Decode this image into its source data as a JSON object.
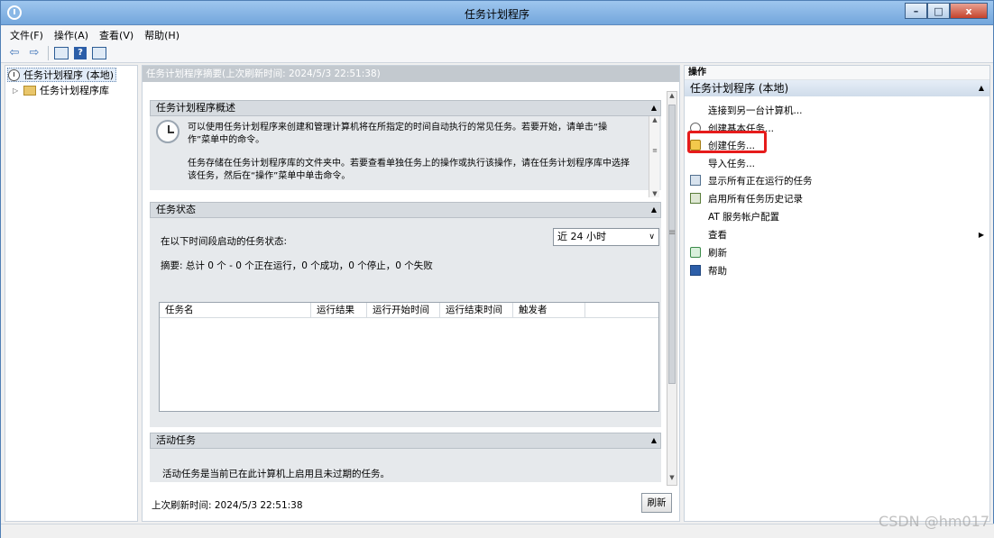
{
  "window": {
    "title": "任务计划程序"
  },
  "window_buttons": {
    "minimize": "–",
    "maximize": "□",
    "close": "x"
  },
  "menu": {
    "file": "文件(F)",
    "action": "操作(A)",
    "view": "查看(V)",
    "help": "帮助(H)"
  },
  "toolbar": {
    "back_glyph": "⇦",
    "forward_glyph": "⇨",
    "help_glyph": "?"
  },
  "tree": {
    "root": "任务计划程序 (本地)",
    "library": "任务计划程序库"
  },
  "center": {
    "header": "任务计划程序摘要(上次刷新时间: 2024/5/3 22:51:38)",
    "overview": {
      "title": "任务计划程序概述",
      "para1": "可以使用任务计划程序来创建和管理计算机将在所指定的时间自动执行的常见任务。若要开始，请单击“操作”菜单中的命令。",
      "para2": "任务存储在任务计划程序库的文件夹中。若要查看单独任务上的操作或执行该操作，请在任务计划程序库中选择该任务，然后在“操作”菜单中单击命令。"
    },
    "status": {
      "title": "任务状态",
      "label": "在以下时间段启动的任务状态:",
      "period": "近 24 小时",
      "summary": "摘要: 总计 0 个 - 0 个正在运行，0 个成功，0 个停止，0 个失败",
      "columns": [
        "任务名",
        "运行结果",
        "运行开始时间",
        "运行结束时间",
        "触发者"
      ]
    },
    "active": {
      "title": "活动任务",
      "text": "活动任务是当前已在此计算机上启用且未过期的任务。"
    },
    "footer": {
      "last_refresh": "上次刷新时间: 2024/5/3 22:51:38",
      "refresh_button": "刷新"
    }
  },
  "actions": {
    "header": "操作",
    "group": "任务计划程序 (本地)",
    "items": [
      {
        "label": "连接到另一台计算机...",
        "icon": "none"
      },
      {
        "label": "创建基本任务...",
        "icon": "clock-icon"
      },
      {
        "label": "创建任务...",
        "icon": "task-icon"
      },
      {
        "label": "导入任务...",
        "icon": "none"
      },
      {
        "label": "显示所有正在运行的任务",
        "icon": "list-icon"
      },
      {
        "label": "启用所有任务历史记录",
        "icon": "history-icon"
      },
      {
        "label": "AT 服务帐户配置",
        "icon": "none"
      },
      {
        "label": "查看",
        "icon": "none"
      },
      {
        "label": "刷新",
        "icon": "refresh-icon"
      },
      {
        "label": "帮助",
        "icon": "help-icon"
      }
    ]
  },
  "watermark": "CSDN @hm017"
}
